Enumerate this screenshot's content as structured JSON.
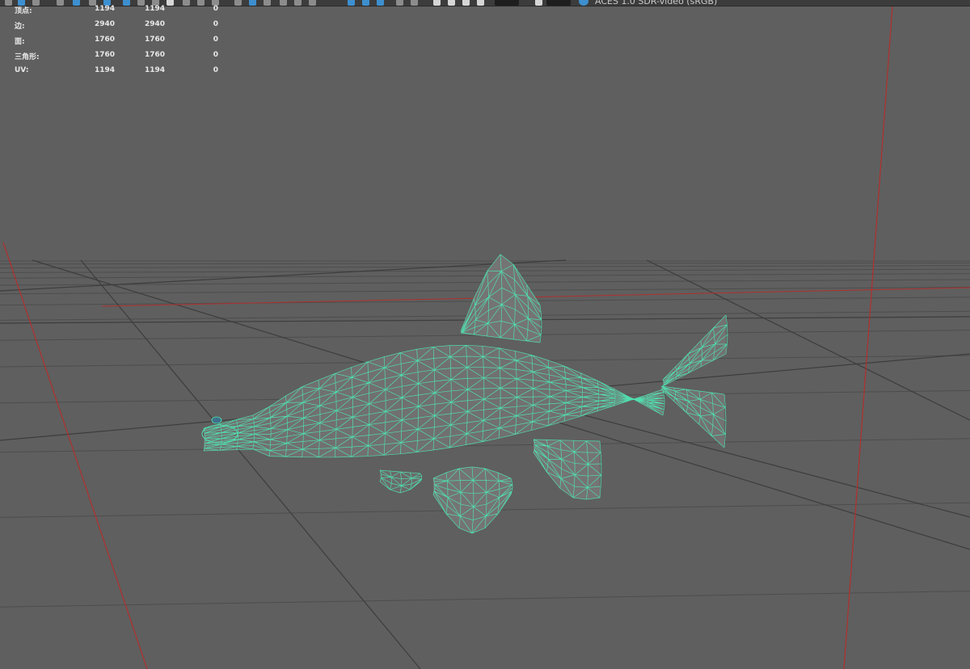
{
  "toolbar": {
    "color_space": "ACES 1.0 SDR-video (sRGB)"
  },
  "hud": {
    "rows": [
      {
        "label": "顶点:",
        "v1": "1194",
        "v2": "1194",
        "v3": "0"
      },
      {
        "label": "边:",
        "v1": "2940",
        "v2": "2940",
        "v3": "0"
      },
      {
        "label": "面:",
        "v1": "1760",
        "v2": "1760",
        "v3": "0"
      },
      {
        "label": "三角形:",
        "v1": "1760",
        "v2": "1760",
        "v3": "0"
      },
      {
        "label": "UV:",
        "v1": "1194",
        "v2": "1194",
        "v3": "0"
      }
    ]
  },
  "colors": {
    "viewport_bg": "#5f5f5f",
    "grid_line": "#4d4d4d",
    "axis_red": "#b0302e",
    "wireframe": "#4fe3b0"
  },
  "icons": [
    "toolbar-button-icon",
    "color-space-icon"
  ]
}
